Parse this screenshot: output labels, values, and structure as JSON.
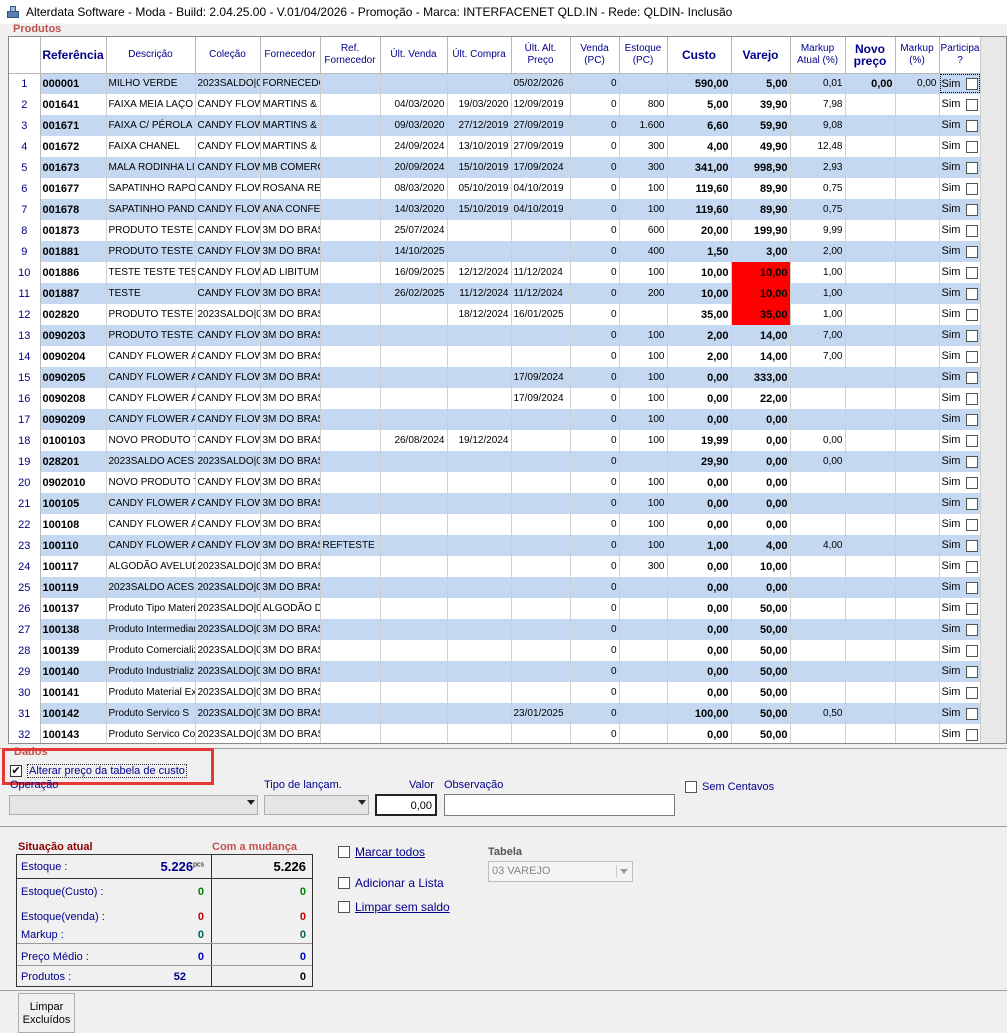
{
  "window": {
    "title": "Alterdata Software - Moda - Build: 2.04.25.00 - V.01/04/2026 - Promoção - Marca: INTERFACENET QLD.IN - Rede: QLDIN- Inclusão"
  },
  "produtos": {
    "group_title": "Produtos",
    "columns": [
      "",
      "Referência",
      "Descrição",
      "Coleção",
      "Fornecedor",
      "Ref. Fornecedor",
      "Últ. Venda",
      "Últ. Compra",
      "Últ. Alt. Preço",
      "Venda (PC)",
      "Estoque (PC)",
      "Custo",
      "Varejo",
      "Markup Atual (%)",
      "Novo preço",
      "Markup (%)",
      "Participa ?"
    ],
    "rows": [
      {
        "n": "1",
        "ref": "000001",
        "desc": "MILHO VERDE",
        "colecao": "2023SALDO|0(",
        "forn": "FORNECEDO",
        "refforn": "",
        "uvenda": "",
        "ucompra": "",
        "ualt": "05/02/2026",
        "venda": "0",
        "estoque": "",
        "custo": "590,00",
        "varejo": "5,00",
        "markup": "0,01",
        "novo": "0,00",
        "mk2": "0,00",
        "part": "Sim"
      },
      {
        "n": "2",
        "ref": "001641",
        "desc": "FAIXA MEIA LAÇO (",
        "colecao": "CANDY FLOW",
        "forn": "MARTINS & M",
        "refforn": "",
        "uvenda": "04/03/2020",
        "ucompra": "19/03/2020",
        "ualt": "12/09/2019",
        "venda": "0",
        "estoque": "800",
        "custo": "5,00",
        "varejo": "39,90",
        "markup": "7,98",
        "novo": "",
        "mk2": "",
        "part": "Sim"
      },
      {
        "n": "3",
        "ref": "001671",
        "desc": "FAIXA C/ PÉROLA",
        "colecao": "CANDY FLOW",
        "forn": "MARTINS & M",
        "refforn": "",
        "uvenda": "09/03/2020",
        "ucompra": "27/12/2019",
        "ualt": "27/09/2019",
        "venda": "0",
        "estoque": "1.600",
        "custo": "6,60",
        "varejo": "59,90",
        "markup": "9,08",
        "novo": "",
        "mk2": "",
        "part": "Sim"
      },
      {
        "n": "4",
        "ref": "001672",
        "desc": "FAIXA CHANEL",
        "colecao": "CANDY FLOW",
        "forn": "MARTINS & M",
        "refforn": "",
        "uvenda": "24/09/2024",
        "ucompra": "13/10/2019",
        "ualt": "27/09/2019",
        "venda": "0",
        "estoque": "300",
        "custo": "4,00",
        "varejo": "49,90",
        "markup": "12,48",
        "novo": "",
        "mk2": "",
        "part": "Sim"
      },
      {
        "n": "5",
        "ref": "001673",
        "desc": "MALA RODINHA LIS",
        "colecao": "CANDY FLOW",
        "forn": "MB COMERCI",
        "refforn": "",
        "uvenda": "20/09/2024",
        "ucompra": "15/10/2019",
        "ualt": "17/09/2024",
        "venda": "0",
        "estoque": "300",
        "custo": "341,00",
        "varejo": "998,90",
        "markup": "2,93",
        "novo": "",
        "mk2": "",
        "part": "Sim"
      },
      {
        "n": "6",
        "ref": "001677",
        "desc": "SAPATINHO RAPOS",
        "colecao": "CANDY FLOW",
        "forn": "ROSANA RES",
        "refforn": "",
        "uvenda": "08/03/2020",
        "ucompra": "05/10/2019",
        "ualt": "04/10/2019",
        "venda": "0",
        "estoque": "100",
        "custo": "119,60",
        "varejo": "89,90",
        "markup": "0,75",
        "novo": "",
        "mk2": "",
        "part": "Sim"
      },
      {
        "n": "7",
        "ref": "001678",
        "desc": "SAPATINHO PANDA",
        "colecao": "CANDY FLOW",
        "forn": "ANA CONFEC",
        "refforn": "",
        "uvenda": "14/03/2020",
        "ucompra": "15/10/2019",
        "ualt": "04/10/2019",
        "venda": "0",
        "estoque": "100",
        "custo": "119,60",
        "varejo": "89,90",
        "markup": "0,75",
        "novo": "",
        "mk2": "",
        "part": "Sim"
      },
      {
        "n": "8",
        "ref": "001873",
        "desc": "PRODUTO TESTE 8",
        "colecao": "CANDY FLOW",
        "forn": "3M DO BRASI",
        "refforn": "",
        "uvenda": "25/07/2024",
        "ucompra": "",
        "ualt": "",
        "venda": "0",
        "estoque": "600",
        "custo": "20,00",
        "varejo": "199,90",
        "markup": "9,99",
        "novo": "",
        "mk2": "",
        "part": "Sim"
      },
      {
        "n": "9",
        "ref": "001881",
        "desc": "PRODUTO TESTE 1",
        "colecao": "CANDY FLOW",
        "forn": "3M DO BRASI",
        "refforn": "",
        "uvenda": "14/10/2025",
        "ucompra": "",
        "ualt": "",
        "venda": "0",
        "estoque": "400",
        "custo": "1,50",
        "varejo": "3,00",
        "markup": "2,00",
        "novo": "",
        "mk2": "",
        "part": "Sim"
      },
      {
        "n": "10",
        "ref": "001886",
        "desc": "TESTE TESTE TEST",
        "colecao": "CANDY FLOW",
        "forn": "AD LIBITUM C",
        "refforn": "",
        "uvenda": "16/09/2025",
        "ucompra": "12/12/2024",
        "ualt": "11/12/2024",
        "venda": "0",
        "estoque": "100",
        "custo": "10,00",
        "varejo": "10,00",
        "markup": "1,00",
        "novo": "",
        "mk2": "",
        "part": "Sim",
        "red": true
      },
      {
        "n": "11",
        "ref": "001887",
        "desc": "TESTE",
        "colecao": "CANDY FLOW",
        "forn": "3M DO BRASI",
        "refforn": "",
        "uvenda": "26/02/2025",
        "ucompra": "11/12/2024",
        "ualt": "11/12/2024",
        "venda": "0",
        "estoque": "200",
        "custo": "10,00",
        "varejo": "10,00",
        "markup": "1,00",
        "novo": "",
        "mk2": "",
        "part": "Sim",
        "red": true
      },
      {
        "n": "12",
        "ref": "002820",
        "desc": "PRODUTO TESTE C",
        "colecao": "2023SALDO|0(",
        "forn": "3M DO BRASI",
        "refforn": "",
        "uvenda": "",
        "ucompra": "18/12/2024",
        "ualt": "16/01/2025",
        "venda": "0",
        "estoque": "",
        "custo": "35,00",
        "varejo": "35,00",
        "markup": "1,00",
        "novo": "",
        "mk2": "",
        "part": "Sim",
        "red": true
      },
      {
        "n": "13",
        "ref": "0090203",
        "desc": "PRODUTO TESTE C",
        "colecao": "CANDY FLOW",
        "forn": "3M DO BRASI",
        "refforn": "",
        "uvenda": "",
        "ucompra": "",
        "ualt": "",
        "venda": "0",
        "estoque": "100",
        "custo": "2,00",
        "varejo": "14,00",
        "markup": "7,00",
        "novo": "",
        "mk2": "",
        "part": "Sim"
      },
      {
        "n": "14",
        "ref": "0090204",
        "desc": "CANDY FLOWER A",
        "colecao": "CANDY FLOW",
        "forn": "3M DO BRASI",
        "refforn": "",
        "uvenda": "",
        "ucompra": "",
        "ualt": "",
        "venda": "0",
        "estoque": "100",
        "custo": "2,00",
        "varejo": "14,00",
        "markup": "7,00",
        "novo": "",
        "mk2": "",
        "part": "Sim"
      },
      {
        "n": "15",
        "ref": "0090205",
        "desc": "CANDY FLOWER A",
        "colecao": "CANDY FLOW",
        "forn": "3M DO BRASI",
        "refforn": "",
        "uvenda": "",
        "ucompra": "",
        "ualt": "17/09/2024",
        "venda": "0",
        "estoque": "100",
        "custo": "0,00",
        "varejo": "333,00",
        "markup": "",
        "novo": "",
        "mk2": "",
        "part": "Sim"
      },
      {
        "n": "16",
        "ref": "0090208",
        "desc": "CANDY FLOWER A",
        "colecao": "CANDY FLOW",
        "forn": "3M DO BRASI",
        "refforn": "",
        "uvenda": "",
        "ucompra": "",
        "ualt": "17/09/2024",
        "venda": "0",
        "estoque": "100",
        "custo": "0,00",
        "varejo": "22,00",
        "markup": "",
        "novo": "",
        "mk2": "",
        "part": "Sim"
      },
      {
        "n": "17",
        "ref": "0090209",
        "desc": "CANDY FLOWER A",
        "colecao": "CANDY FLOW",
        "forn": "3M DO BRASI",
        "refforn": "",
        "uvenda": "",
        "ucompra": "",
        "ualt": "",
        "venda": "0",
        "estoque": "100",
        "custo": "0,00",
        "varejo": "0,00",
        "markup": "",
        "novo": "",
        "mk2": "",
        "part": "Sim"
      },
      {
        "n": "18",
        "ref": "0100103",
        "desc": "NOVO PRODUTO T",
        "colecao": "CANDY FLOW",
        "forn": "3M DO BRASI",
        "refforn": "",
        "uvenda": "26/08/2024",
        "ucompra": "19/12/2024",
        "ualt": "",
        "venda": "0",
        "estoque": "100",
        "custo": "19,99",
        "varejo": "0,00",
        "markup": "0,00",
        "novo": "",
        "mk2": "",
        "part": "Sim"
      },
      {
        "n": "19",
        "ref": "028201",
        "desc": "2023SALDO ACESS",
        "colecao": "2023SALDO|0(",
        "forn": "3M DO BRASI",
        "refforn": "",
        "uvenda": "",
        "ucompra": "",
        "ualt": "",
        "venda": "0",
        "estoque": "",
        "custo": "29,90",
        "varejo": "0,00",
        "markup": "0,00",
        "novo": "",
        "mk2": "",
        "part": "Sim"
      },
      {
        "n": "20",
        "ref": "0902010",
        "desc": "NOVO PRODUTO T",
        "colecao": "CANDY FLOW",
        "forn": "3M DO BRASI",
        "refforn": "",
        "uvenda": "",
        "ucompra": "",
        "ualt": "",
        "venda": "0",
        "estoque": "100",
        "custo": "0,00",
        "varejo": "0,00",
        "markup": "",
        "novo": "",
        "mk2": "",
        "part": "Sim"
      },
      {
        "n": "21",
        "ref": "100105",
        "desc": "CANDY FLOWER A",
        "colecao": "CANDY FLOW",
        "forn": "3M DO BRASI",
        "refforn": "",
        "uvenda": "",
        "ucompra": "",
        "ualt": "",
        "venda": "0",
        "estoque": "100",
        "custo": "0,00",
        "varejo": "0,00",
        "markup": "",
        "novo": "",
        "mk2": "",
        "part": "Sim"
      },
      {
        "n": "22",
        "ref": "100108",
        "desc": "CANDY FLOWER A",
        "colecao": "CANDY FLOW",
        "forn": "3M DO BRASI",
        "refforn": "",
        "uvenda": "",
        "ucompra": "",
        "ualt": "",
        "venda": "0",
        "estoque": "100",
        "custo": "0,00",
        "varejo": "0,00",
        "markup": "",
        "novo": "",
        "mk2": "",
        "part": "Sim"
      },
      {
        "n": "23",
        "ref": "100110",
        "desc": "CANDY FLOWER A",
        "colecao": "CANDY FLOW",
        "forn": "3M DO BRASI",
        "refforn": "REFTESTE",
        "uvenda": "",
        "ucompra": "",
        "ualt": "",
        "venda": "0",
        "estoque": "100",
        "custo": "1,00",
        "varejo": "4,00",
        "markup": "4,00",
        "novo": "",
        "mk2": "",
        "part": "Sim"
      },
      {
        "n": "24",
        "ref": "100117",
        "desc": "ALGODÃO AVELUD",
        "colecao": "2023SALDO|0(",
        "forn": "3M DO BRASI",
        "refforn": "",
        "uvenda": "",
        "ucompra": "",
        "ualt": "",
        "venda": "0",
        "estoque": "300",
        "custo": "0,00",
        "varejo": "10,00",
        "markup": "",
        "novo": "",
        "mk2": "",
        "part": "Sim"
      },
      {
        "n": "25",
        "ref": "100119",
        "desc": "2023SALDO ACESS",
        "colecao": "2023SALDO|0(",
        "forn": "3M DO BRASI",
        "refforn": "",
        "uvenda": "",
        "ucompra": "",
        "ualt": "",
        "venda": "0",
        "estoque": "",
        "custo": "0,00",
        "varejo": "0,00",
        "markup": "",
        "novo": "",
        "mk2": "",
        "part": "Sim"
      },
      {
        "n": "26",
        "ref": "100137",
        "desc": "Produto Tipo Materia",
        "colecao": "2023SALDO|0(",
        "forn": "ALGODÃO DC",
        "refforn": "",
        "uvenda": "",
        "ucompra": "",
        "ualt": "",
        "venda": "0",
        "estoque": "",
        "custo": "0,00",
        "varejo": "50,00",
        "markup": "",
        "novo": "",
        "mk2": "",
        "part": "Sim"
      },
      {
        "n": "27",
        "ref": "100138",
        "desc": "Produto Intermediari",
        "colecao": "2023SALDO|0(",
        "forn": "3M DO BRASI",
        "refforn": "",
        "uvenda": "",
        "ucompra": "",
        "ualt": "",
        "venda": "0",
        "estoque": "",
        "custo": "0,00",
        "varejo": "50,00",
        "markup": "",
        "novo": "",
        "mk2": "",
        "part": "Sim"
      },
      {
        "n": "28",
        "ref": "100139",
        "desc": "Produto Comercializ",
        "colecao": "2023SALDO|0(",
        "forn": "3M DO BRASI",
        "refforn": "",
        "uvenda": "",
        "ucompra": "",
        "ualt": "",
        "venda": "0",
        "estoque": "",
        "custo": "0,00",
        "varejo": "50,00",
        "markup": "",
        "novo": "",
        "mk2": "",
        "part": "Sim"
      },
      {
        "n": "29",
        "ref": "100140",
        "desc": "Produto Industrializ",
        "colecao": "2023SALDO|0(",
        "forn": "3M DO BRASI",
        "refforn": "",
        "uvenda": "",
        "ucompra": "",
        "ualt": "",
        "venda": "0",
        "estoque": "",
        "custo": "0,00",
        "varejo": "50,00",
        "markup": "",
        "novo": "",
        "mk2": "",
        "part": "Sim"
      },
      {
        "n": "30",
        "ref": "100141",
        "desc": "Produto Material Exp",
        "colecao": "2023SALDO|0(",
        "forn": "3M DO BRASI",
        "refforn": "",
        "uvenda": "",
        "ucompra": "",
        "ualt": "",
        "venda": "0",
        "estoque": "",
        "custo": "0,00",
        "varejo": "50,00",
        "markup": "",
        "novo": "",
        "mk2": "",
        "part": "Sim"
      },
      {
        "n": "31",
        "ref": "100142",
        "desc": "Produto Servico S",
        "colecao": "2023SALDO|0(",
        "forn": "3M DO BRASI",
        "refforn": "",
        "uvenda": "",
        "ucompra": "",
        "ualt": "23/01/2025",
        "venda": "0",
        "estoque": "",
        "custo": "100,00",
        "varejo": "50,00",
        "markup": "0,50",
        "novo": "",
        "mk2": "",
        "part": "Sim"
      },
      {
        "n": "32",
        "ref": "100143",
        "desc": "Produto Servico Cor",
        "colecao": "2023SALDO|0(",
        "forn": "3M DO BRASI",
        "refforn": "",
        "uvenda": "",
        "ucompra": "",
        "ualt": "",
        "venda": "0",
        "estoque": "",
        "custo": "0,00",
        "varejo": "50,00",
        "markup": "",
        "novo": "",
        "mk2": "",
        "part": "Sim"
      }
    ]
  },
  "dados": {
    "group_title": "Dados",
    "alterar_label": "Alterar preço da tabela de custo",
    "alterar_checked": "✔",
    "operacao_label": "Operação",
    "tipo_label": "Tipo de lançam.",
    "valor_label": "Valor",
    "valor": "0,00",
    "observacao_label": "Observação",
    "sem_centavos_label": "Sem Centavos"
  },
  "situacao": {
    "atual_title": "Situação atual",
    "mudanca_title": "Com a mudança",
    "rows": [
      {
        "label": "Estoque :",
        "atual": "5.226",
        "unit": "pcs",
        "mudanca": "5.226"
      },
      {
        "label": "Estoque(Custo) :",
        "atual": "0",
        "mudanca": "0"
      },
      {
        "label": "Estoque(venda) :",
        "atual": "0",
        "mudanca": "0"
      },
      {
        "label": "Markup :",
        "atual": "0",
        "mudanca": "0"
      },
      {
        "label": "Preço Médio :",
        "atual": "0",
        "mudanca": "0"
      },
      {
        "label": "Produtos :",
        "atual": "52",
        "mudanca": "0"
      }
    ]
  },
  "opcoes": {
    "marcar_todos": "Marcar todos",
    "adicionar_lista": "Adicionar a Lista",
    "limpar_sem_saldo": "Limpar sem saldo",
    "tabela_label": "Tabela",
    "tabela_value": "03 VAREJO"
  },
  "footer": {
    "limpar_excluidos": "Limpar Excluídos"
  },
  "colors": {
    "row_alt": "#c4d9f1",
    "highlight_red": "#ff0000",
    "header_blue": "#00008b",
    "annotation_box": "#e53935"
  }
}
